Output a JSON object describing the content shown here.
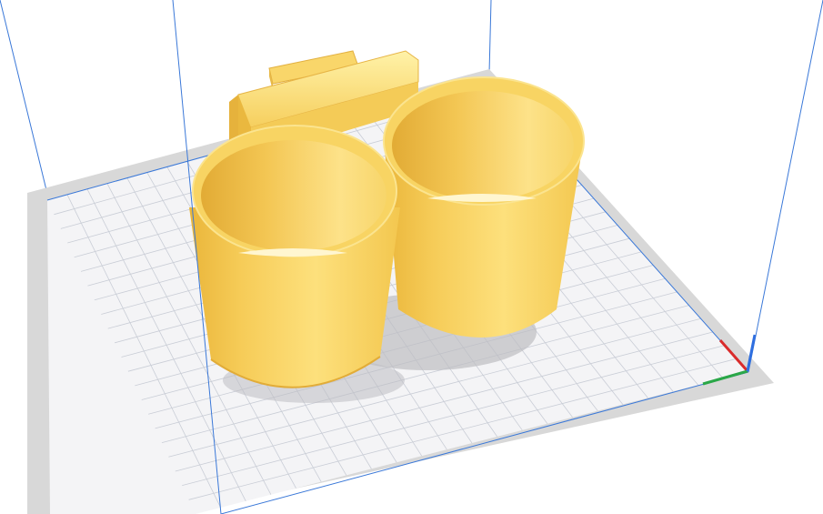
{
  "app": {
    "view": "3d-viewport"
  },
  "colors": {
    "background": "#ffffff",
    "plate_border": "#d9d9d9",
    "plate_surface": "#f4f4f6",
    "grid_line": "#c9cdd6",
    "build_volume_edge": "#3a78d8",
    "model_light": "#ffe58a",
    "model_mid": "#fcd565",
    "model_dark": "#e9b63c",
    "model_shadow": "#b9b9bd",
    "axis_x": "#d92b2b",
    "axis_y": "#2aa748",
    "axis_z": "#2f6fe0"
  },
  "icons": {
    "axis_indicator": "xyz-axis-icon"
  }
}
